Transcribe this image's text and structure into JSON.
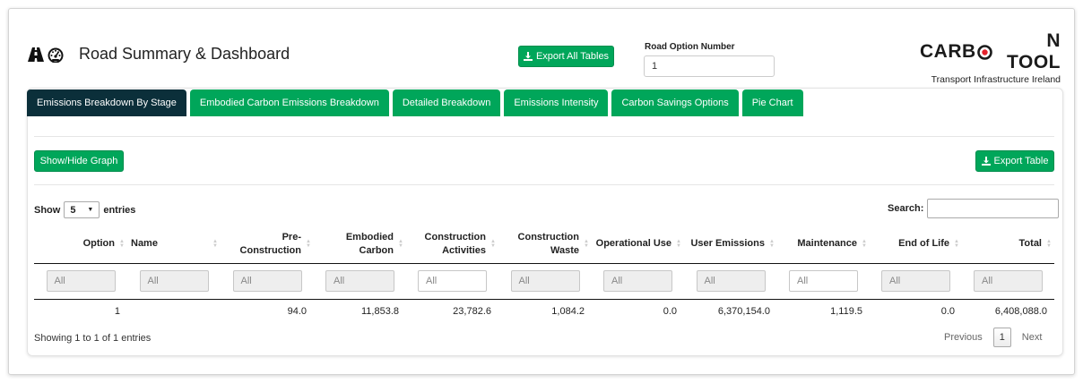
{
  "header": {
    "title": "Road Summary & Dashboard",
    "icons": [
      "road-icon",
      "tachometer-icon"
    ],
    "export_all_label": "Export All Tables",
    "road_option_label": "Road Option Number",
    "road_option_value": "1"
  },
  "brand": {
    "title_pre": "CARB",
    "title_post": "N TOOL",
    "subtitle": "Transport Infrastructure Ireland",
    "accent_color": "#e4222c"
  },
  "tabs": [
    {
      "label": "Emissions Breakdown By Stage",
      "active": true
    },
    {
      "label": "Embodied Carbon Emissions Breakdown",
      "active": false
    },
    {
      "label": "Detailed Breakdown",
      "active": false
    },
    {
      "label": "Emissions Intensity",
      "active": false
    },
    {
      "label": "Carbon Savings Options",
      "active": false
    },
    {
      "label": "Pie Chart",
      "active": false
    }
  ],
  "toolbar": {
    "show_hide_label": "Show/Hide Graph",
    "export_table_label": "Export Table"
  },
  "table": {
    "show_label": "Show",
    "entries_value": "5",
    "entries_label": "entries",
    "search_label": "Search:",
    "columns": [
      {
        "label": "Option",
        "align": "right"
      },
      {
        "label": "Name",
        "align": "left"
      },
      {
        "label": "Pre-Construction",
        "align": "right"
      },
      {
        "label": "Embodied Carbon",
        "align": "right"
      },
      {
        "label": "Construction Activities",
        "align": "right"
      },
      {
        "label": "Construction Waste",
        "align": "right"
      },
      {
        "label": "Operational Use",
        "align": "right"
      },
      {
        "label": "User Emissions",
        "align": "right"
      },
      {
        "label": "Maintenance",
        "align": "right"
      },
      {
        "label": "End of Life",
        "align": "right"
      },
      {
        "label": "Total",
        "align": "right"
      }
    ],
    "filters": [
      "All",
      "All",
      "All",
      "All",
      "All",
      "All",
      "All",
      "All",
      "All",
      "All",
      "All"
    ],
    "filter_enabled": [
      false,
      false,
      false,
      false,
      true,
      false,
      false,
      false,
      true,
      false,
      false
    ],
    "rows": [
      [
        "1",
        "",
        "94.0",
        "11,853.8",
        "23,782.6",
        "1,084.2",
        "0.0",
        "6,370,154.0",
        "1,119.5",
        "0.0",
        "6,408,088.0"
      ]
    ],
    "info": "Showing 1 to 1 of 1 entries",
    "pager": {
      "previous": "Previous",
      "current": "1",
      "next": "Next"
    }
  },
  "colors": {
    "button_green": "#00a65a",
    "active_tab": "#0b2f3a"
  }
}
